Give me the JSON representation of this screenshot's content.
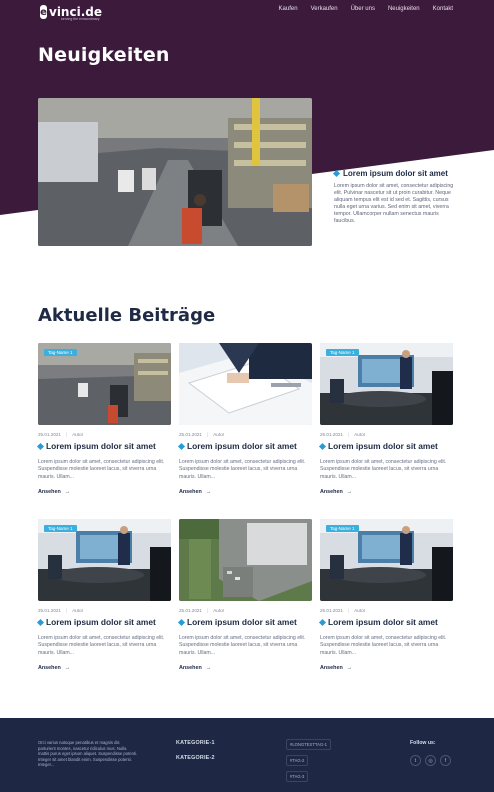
{
  "brand": {
    "logo_letter": "e",
    "logo_name": "vinci.de",
    "tagline": "serving the extraordinary"
  },
  "nav": {
    "items": [
      "Kaufen",
      "Verkaufen",
      "Über uns",
      "Neuigkeiten",
      "Kontakt"
    ]
  },
  "hero": {
    "title": "Neuigkeiten",
    "feature_title": "Lorem ipsum dolor sit amet",
    "feature_text": "Lorem ipsum dolor sit amet, consectetur adipiscing elit. Pulvinar nascetur sit ut proin curabitur. Neque aliquam tempus elit est id sed et. Sagittis, cursus nulla eget urna varius. Sed enim sit amet, viverra tempor. Ullamcorper nullam senectus mauris faucibus."
  },
  "section": {
    "title": "Aktuelle Beiträge"
  },
  "cards": [
    {
      "tag": "Tag-Name 1",
      "date": "25.01.2021",
      "author": "Autor",
      "title": "Lorem ipsum dolor sit amet",
      "text": "Lorem ipsum dolor sit amet, consectetur adipiscing elit. Suspendisse molestie laoreet lacus, sit viverra urna mauris. Ullam...",
      "link": "Ansehen",
      "image": "warehouse"
    },
    {
      "tag": "",
      "date": "25.01.2021",
      "author": "Autor",
      "title": "Lorem ipsum dolor sit amet",
      "text": "Lorem ipsum dolor sit amet, consectetur adipiscing elit. Suspendisse molestie laoreet lacus, sit viverra urna mauris. Ullam...",
      "link": "Ansehen",
      "image": "documents"
    },
    {
      "tag": "Tag-Name 1",
      "date": "25.01.2021",
      "author": "Autor",
      "title": "Lorem ipsum dolor sit amet",
      "text": "Lorem ipsum dolor sit amet, consectetur adipiscing elit. Suspendisse molestie laoreet lacus, sit viverra urna mauris. Ullam...",
      "link": "Ansehen",
      "image": "meeting"
    },
    {
      "tag": "Tag-Name 1",
      "date": "25.01.2021",
      "author": "Autor",
      "title": "Lorem ipsum dolor sit amet",
      "text": "Lorem ipsum dolor sit amet, consectetur adipiscing elit. Suspendisse molestie laoreet lacus, sit viverra urna mauris. Ullam...",
      "link": "Ansehen",
      "image": "meeting"
    },
    {
      "tag": "",
      "date": "25.01.2021",
      "author": "Autor",
      "title": "Lorem ipsum dolor sit amet",
      "text": "Lorem ipsum dolor sit amet, consectetur adipiscing elit. Suspendisse molestie laoreet lacus, sit viverra urna mauris. Ullam...",
      "link": "Ansehen",
      "image": "aerial"
    },
    {
      "tag": "Tag-Name 1",
      "date": "25.01.2021",
      "author": "Autor",
      "title": "Lorem ipsum dolor sit amet",
      "text": "Lorem ipsum dolor sit amet, consectetur adipiscing elit. Suspendisse molestie laoreet lacus, sit viverra urna mauris. Ullam...",
      "link": "Ansehen",
      "image": "meeting"
    }
  ],
  "footer": {
    "about": "Orci varius natoque penatibus et magnis dis parturient montes, nascetur ridiculus mus. Nulla mattis purus eget ipsum aliquet. Suspendisse potenti. Integer sit amet blandit enim. Suspendisse potenti. Integer...",
    "categories": [
      "KATEGORIE-1",
      "KATEGORIE-2"
    ],
    "tags": [
      "#LONGTEXTTAG-1",
      "#TAG-2",
      "#TAG-3"
    ],
    "follow_title": "Follow us:",
    "socials": [
      "twitter-icon",
      "instagram-icon",
      "facebook-icon"
    ]
  },
  "colors": {
    "hero_bg": "#3b1a3c",
    "accent": "#2b9bd8",
    "tag_bg": "#3ab0e0",
    "footer_bg": "#1e2845",
    "text_dark": "#1f2a44"
  }
}
